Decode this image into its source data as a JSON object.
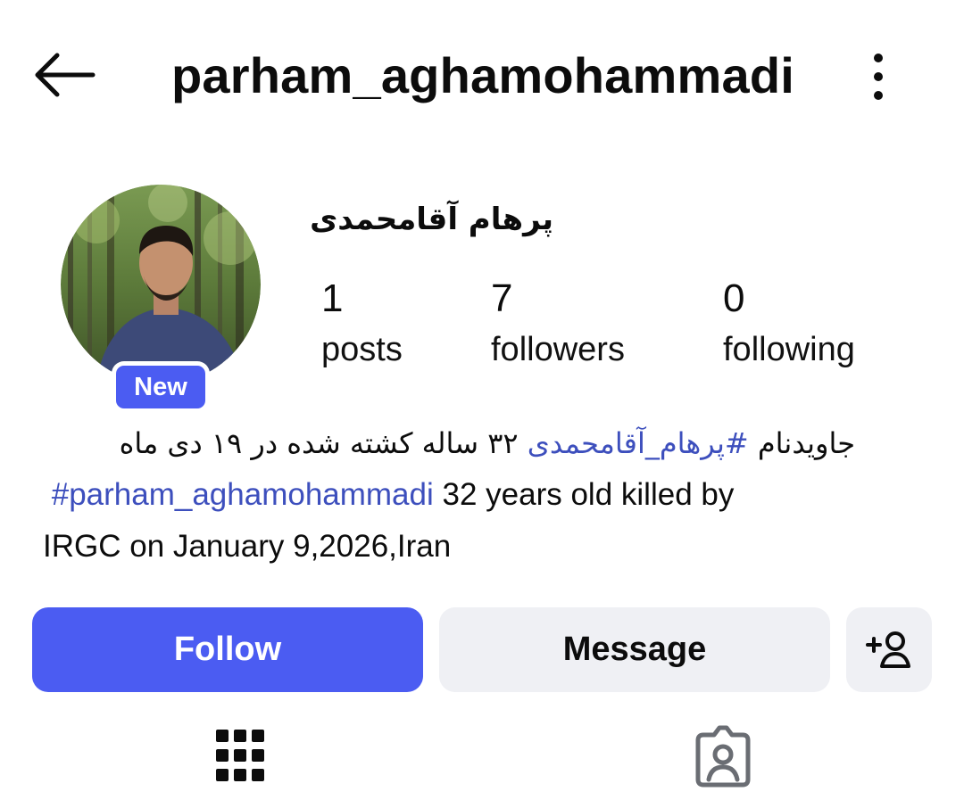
{
  "header": {
    "username": "parham_aghamohammadi",
    "back_icon": "arrow-left-icon",
    "more_icon": "more-vertical-icon"
  },
  "profile": {
    "avatar_icon": "profile-photo",
    "badge": "New",
    "full_name": "پرهام آقامحمدی",
    "stats": [
      {
        "value": "1",
        "label": "posts"
      },
      {
        "value": "7",
        "label": "followers"
      },
      {
        "value": "0",
        "label": "following"
      }
    ]
  },
  "bio": {
    "fa_prefix": "جاویدنام ",
    "fa_hashtag": "#پرهام_آقامحمدی",
    "fa_suffix": " ۳۲ ساله کشته شده در ۱۹ دی ماه",
    "en_hashtag": "#parham_aghamohammadi",
    "en_line1_rest": " 32 years old killed by",
    "en_line2": "IRGC on January 9,2026,Iran"
  },
  "actions": {
    "follow_label": "Follow",
    "message_label": "Message",
    "add_user_icon": "add-user-icon"
  },
  "tabs": [
    {
      "icon": "grid-icon"
    },
    {
      "icon": "tagged-user-icon"
    }
  ],
  "colors": {
    "accent": "#4b5cf2",
    "hashtag": "#3d4fbd",
    "secondary_button": "#eff0f4"
  }
}
